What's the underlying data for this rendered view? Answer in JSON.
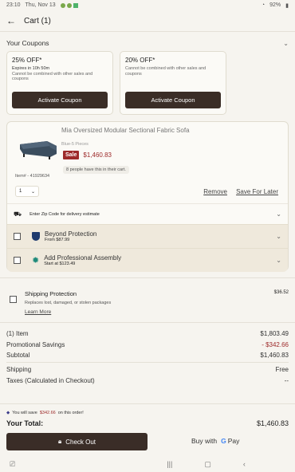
{
  "status": {
    "time": "23:10",
    "date": "Thu, Nov 13",
    "battery": "92%"
  },
  "header": {
    "title": "Cart (1)"
  },
  "coupons": {
    "label": "Your Coupons",
    "items": [
      {
        "pct": "25% OFF*",
        "expires": "Expires in 10h 50m",
        "note": "Cannot be combined with other sales and coupons",
        "button": "Activate Coupon"
      },
      {
        "pct": "20% OFF*",
        "expires": "",
        "note": "Cannot be combined with other sales and coupons",
        "button": "Activate Coupon"
      }
    ]
  },
  "item": {
    "name": "Mia Oversized Modular Sectional Fabric Sofa",
    "variant": "Blue-5 Pieces",
    "sale_label": "Sale",
    "price": "$1,460.83",
    "item_number": "Item# - 41929634",
    "cart_note": "8 people have this in their cart.",
    "qty": "1",
    "remove": "Remove",
    "save_later": "Save For Later",
    "zip_text": "Enter Zip Code for delivery estimate"
  },
  "protection": {
    "name": "Beyond Protection",
    "sub": "From $87.99"
  },
  "assembly": {
    "name": "Add Professional Assembly",
    "sub": "Start at $123.49"
  },
  "shipping_protection": {
    "title": "Shipping Protection",
    "desc": "Replaces lost, damaged, or stolen packages",
    "learn": "Learn More",
    "price": "$36.52"
  },
  "summary": {
    "items_label": "(1) Item",
    "items_val": "$1,803.49",
    "promo_label": "Promotional Savings",
    "promo_val": "- $342.66",
    "subtotal_label": "Subtotal",
    "subtotal_val": "$1,460.83",
    "shipping_label": "Shipping",
    "shipping_val": "Free",
    "taxes_label": "Taxes (Calculated in Checkout)",
    "taxes_val": "--"
  },
  "footer": {
    "save_prefix": "You will save",
    "save_amt": "$342.66",
    "save_suffix": "on this order!",
    "total_label": "Your Total:",
    "total_val": "$1,460.83",
    "checkout": "Check Out",
    "gpay_prefix": "Buy with",
    "gpay_brand": "Pay"
  },
  "colors": {
    "accent": "#3a2d27",
    "sale": "#9d2a2a",
    "background": "#f6f4ef"
  }
}
